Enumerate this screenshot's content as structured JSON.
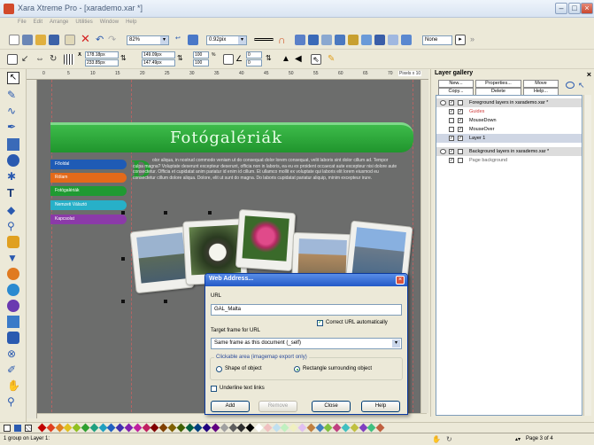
{
  "window": {
    "title": "Xara Xtreme Pro - [xarademo.xar *]",
    "min": "–",
    "max": "□",
    "close": "×"
  },
  "menu": [
    "File",
    "Edit",
    "Arrange",
    "Utilities",
    "Window",
    "Help"
  ],
  "toolbar": {
    "zoom_value": "82%",
    "line_width_value": "0.92pix",
    "fill_none_value": "None"
  },
  "infobar": {
    "x_value": "178.18px",
    "y_value": "233.85px",
    "w_value": "149.09px",
    "h_value": "147.49px",
    "scale_w": "100",
    "scale_h": "100",
    "scale_unit": "%",
    "angle_1": "0",
    "angle_2": "0"
  },
  "ruler": {
    "h_marks": [
      "0",
      "5",
      "10",
      "15",
      "20",
      "25",
      "30",
      "35",
      "40",
      "45",
      "50",
      "55",
      "60",
      "65",
      "70"
    ],
    "unit_label": "Pixels x 10"
  },
  "canvas": {
    "banner_title": "Fotógalériák",
    "nav_items": [
      "Főoldal",
      "Rólam",
      "Fotógalériák",
      "Nemzeti Válsztó",
      "Kapcsolat"
    ],
    "drop_cap": "D",
    "body_text": "olor aliqua, in nostrud commodo veniam ut do consequat dolor lorem consequat, velit laboris sint dolor cillum ad. Tempor culpa magna? Voluptate deserunt excepteur deserunt, officia non in laboris, ea eu ex proident occaecat aute excepteur nisi dolore aute consectetur. Officia et cupidatat anim pariatur id enim id cillum. Et ullamco mollit ex voluptate qui laboris elit lorem eiusmod eu consectetur cillum dolore aliqua. Dolore, elit ut sunt do magna. Do laboris cupidatat pariatur aliquip, minim excepteur irure."
  },
  "dialog": {
    "title": "Web Address...",
    "close": "×",
    "url_label": "URL",
    "url_value": "GAL_Malta",
    "correct_url_label": "Correct URL automatically",
    "correct_url_checked": "✓",
    "target_label": "Target frame for URL",
    "target_value": "Same frame as this document (_self)",
    "clickable_group": "Clickable area (imagemap export only)",
    "shape_label": "Shape of object",
    "rect_label": "Rectangle surrounding object",
    "underline_label": "Underline text links",
    "buttons": {
      "add": "Add",
      "remove": "Remove",
      "close": "Close",
      "help": "Help"
    }
  },
  "layer_gallery": {
    "title": "Layer gallery",
    "close": "×",
    "buttons": [
      "New...",
      "Properties...",
      "Move",
      "Copy...",
      "Delete",
      "Help..."
    ],
    "rows": [
      {
        "label": "Foreground layers in xarademo.xar *",
        "kind": "hdr",
        "check1": "✓",
        "check2": ""
      },
      {
        "label": "Guides",
        "kind": "guides",
        "check1": "✓",
        "check2": "✓"
      },
      {
        "label": "MouseDown",
        "kind": "item",
        "check1": "",
        "check2": "✓"
      },
      {
        "label": "MouseOver",
        "kind": "item",
        "check1": "",
        "check2": "✓"
      },
      {
        "label": "Layer 1",
        "kind": "sel",
        "check1": "✓",
        "check2": "✓"
      },
      {
        "label": "Background layers in xarademo.xar *",
        "kind": "hdr",
        "check1": "✓",
        "check2": ""
      },
      {
        "label": "Page background",
        "kind": "item",
        "check1": "✓",
        "check2": ""
      }
    ]
  },
  "status": {
    "left_text": "1 group on Layer 1:",
    "page_text": "Page 3 of 4"
  },
  "colors": {
    "banner": "#20952d",
    "dialog_title": "#2359c7",
    "nav": [
      "#1f5bb5",
      "#e36a1a",
      "#1f9a32",
      "#27b0c8",
      "#8b3aa8"
    ]
  }
}
